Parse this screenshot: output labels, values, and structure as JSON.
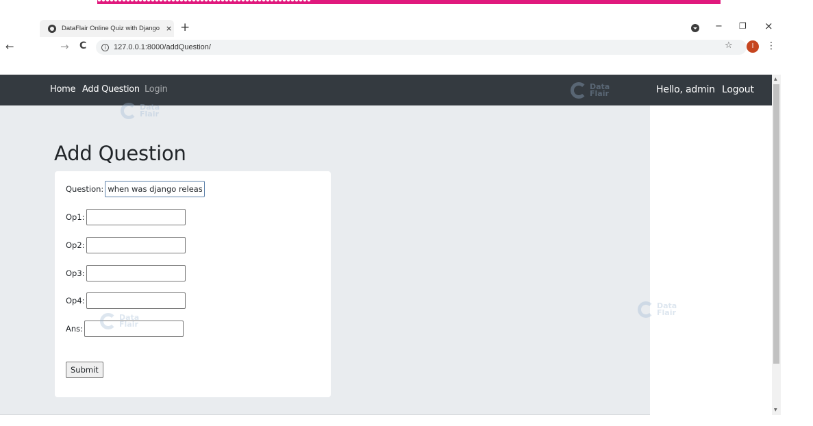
{
  "browser": {
    "tab_title": "DataFlair Online Quiz with Django",
    "tab_close": "×",
    "new_tab": "+",
    "url": "127.0.0.1:8000/addQuestion/",
    "back": "←",
    "forward": "→",
    "reload": "C",
    "info": "i",
    "star": "☆",
    "profile_initial": "I",
    "menu": "⋮",
    "minimize": "−",
    "restore": "❐",
    "close": "×"
  },
  "navbar": {
    "home": "Home",
    "add_question": "Add Question",
    "login": "Login",
    "greeting": "Hello, admin",
    "logout": "Logout"
  },
  "page": {
    "title": "Add Question"
  },
  "form": {
    "question_label": "Question:",
    "question_value": "when was django release",
    "op1_label": "Op1:",
    "op2_label": "Op2:",
    "op3_label": "Op3:",
    "op4_label": "Op4:",
    "ans_label": "Ans:",
    "submit_label": "Submit"
  },
  "watermark": {
    "line1": "Data",
    "line2": "Flair"
  },
  "colors": {
    "navbar": "#343a40",
    "content_bg": "#e9ecef",
    "banner": "#e0197d",
    "avatar": "#c6451f"
  }
}
